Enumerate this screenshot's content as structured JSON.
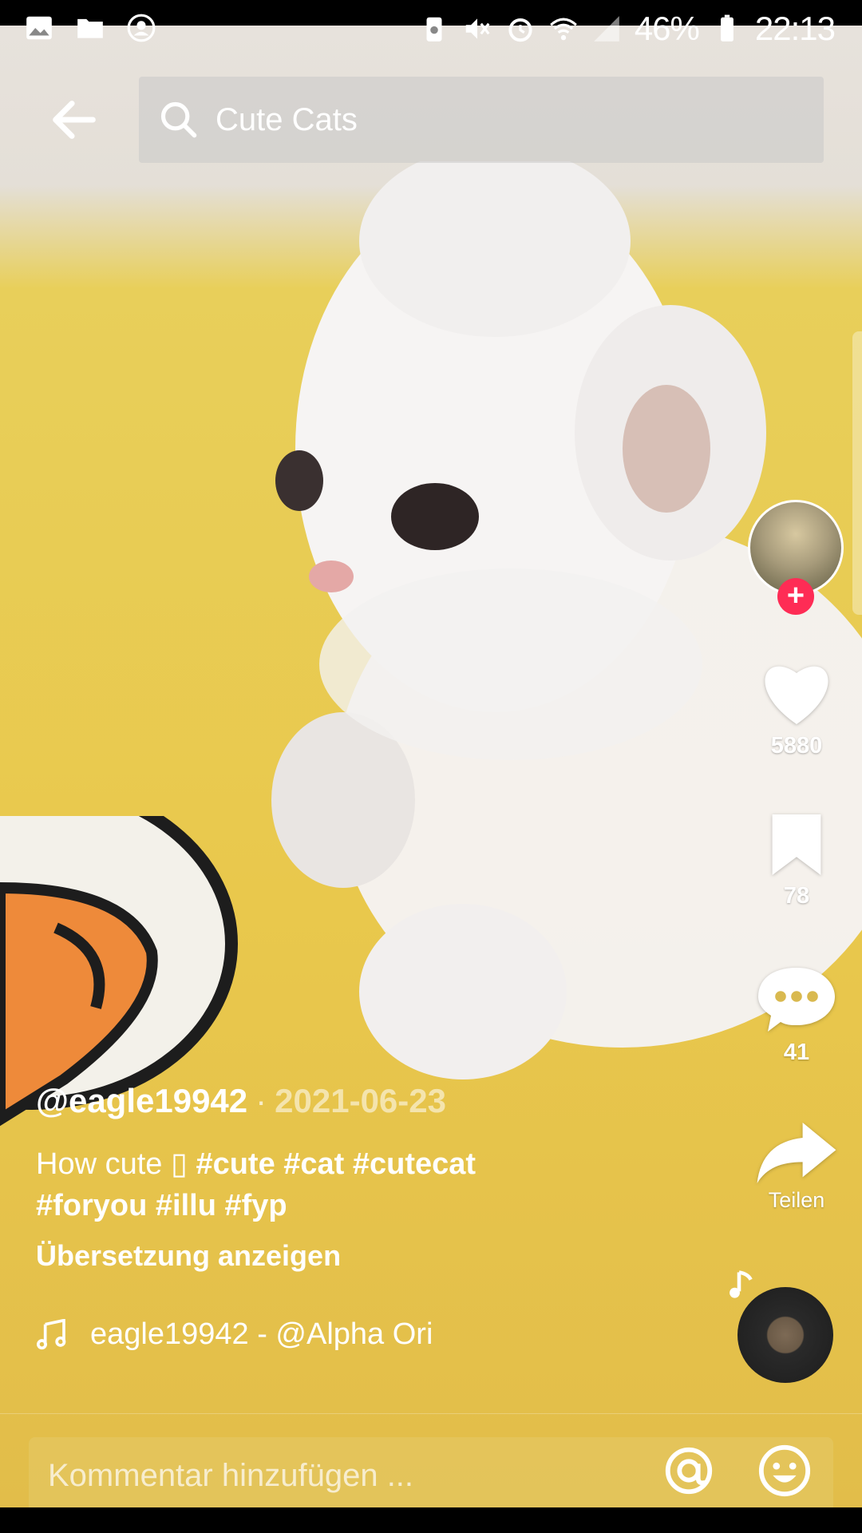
{
  "status_bar": {
    "battery": "46%",
    "time": "22:13",
    "icons_left": [
      "gallery-icon",
      "folder-icon",
      "account-icon"
    ],
    "icons_right": [
      "battery-saver-icon",
      "mute-icon",
      "alarm-icon",
      "wifi-icon",
      "signal-icon",
      "battery-icon"
    ]
  },
  "search": {
    "query": "Cute Cats"
  },
  "actions": {
    "likes": "5880",
    "saves": "78",
    "comments": "41",
    "share_label": "Teilen"
  },
  "post": {
    "author": "@eagle19942",
    "separator": "·",
    "date": "2021-06-23",
    "caption_text": "How cute ",
    "caption_glyph": "▯",
    "hashtags_line1": "#cute #cat #cutecat",
    "hashtags_line2": "#foryou #illu #fyp",
    "translate_label": "Übersetzung anzeigen",
    "music_track": "eagle19942 - @Alpha    Ori"
  },
  "comment": {
    "placeholder": "Kommentar hinzufügen ..."
  },
  "colors": {
    "accent": "#fe2c55",
    "floor": "#e9c84c"
  }
}
